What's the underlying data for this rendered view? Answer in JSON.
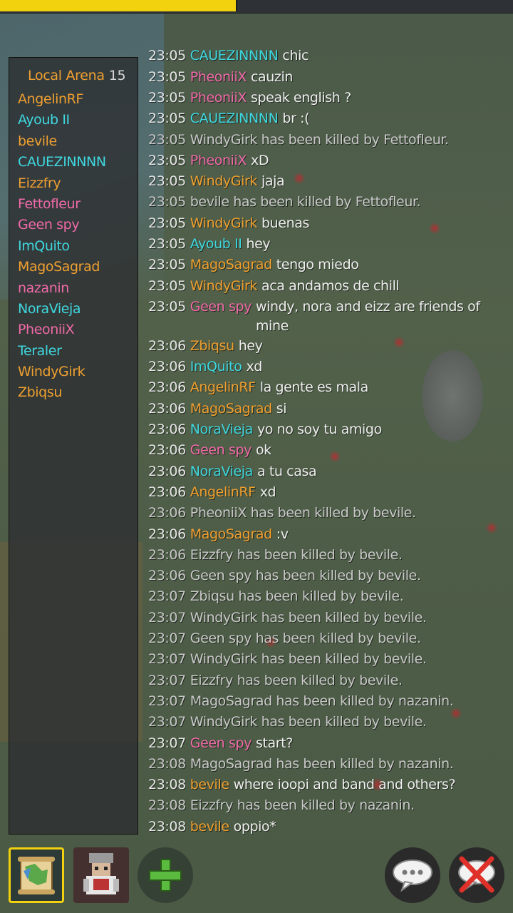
{
  "top_bar": {
    "progress": 0.46
  },
  "sidebar": {
    "title": "Local Arena",
    "count": "15",
    "players": [
      {
        "name": "AngelinRF",
        "color": "#f0a030"
      },
      {
        "name": "Ayoub II",
        "color": "#3fd8e0"
      },
      {
        "name": "bevile",
        "color": "#f0a030"
      },
      {
        "name": "CAUEZINNNN",
        "color": "#3fd8e0"
      },
      {
        "name": "Eizzfry",
        "color": "#f0a030"
      },
      {
        "name": "Fettofleur",
        "color": "#f06aa8"
      },
      {
        "name": "Geen spy",
        "color": "#f06aa8"
      },
      {
        "name": "ImQuito",
        "color": "#3fd8e0"
      },
      {
        "name": "MagoSagrad",
        "color": "#f0a030"
      },
      {
        "name": "nazanin",
        "color": "#f06aa8"
      },
      {
        "name": "NoraVieja",
        "color": "#3fd8e0"
      },
      {
        "name": "PheoniiX",
        "color": "#f06aa8"
      },
      {
        "name": "Teraler",
        "color": "#3fd8e0"
      },
      {
        "name": "WindyGirk",
        "color": "#f0a030"
      },
      {
        "name": "Zbiqsu",
        "color": "#f0a030"
      }
    ]
  },
  "chat": {
    "messages": [
      {
        "time": "23:05",
        "name": "CAUEZINNNN",
        "color": "#3fd8e0",
        "text": "chic"
      },
      {
        "time": "23:05",
        "name": "PheoniiX",
        "color": "#f06aa8",
        "text": "cauzin"
      },
      {
        "time": "23:05",
        "name": "PheoniiX",
        "color": "#f06aa8",
        "text": "speak english ?"
      },
      {
        "time": "23:05",
        "name": "CAUEZINNNN",
        "color": "#3fd8e0",
        "text": "br :("
      },
      {
        "time": "23:05",
        "name": "",
        "color": "",
        "text": "WindyGirk has been killed by Fettofleur."
      },
      {
        "time": "23:05",
        "name": "PheoniiX",
        "color": "#f06aa8",
        "text": "xD"
      },
      {
        "time": "23:05",
        "name": "WindyGirk",
        "color": "#f0a030",
        "text": "jaja"
      },
      {
        "time": "23:05",
        "name": "",
        "color": "",
        "text": "bevile has been killed by Fettofleur."
      },
      {
        "time": "23:05",
        "name": "WindyGirk",
        "color": "#f0a030",
        "text": "buenas"
      },
      {
        "time": "23:05",
        "name": "Ayoub II",
        "color": "#3fd8e0",
        "text": "hey"
      },
      {
        "time": "23:05",
        "name": "MagoSagrad",
        "color": "#f0a030",
        "text": "tengo miedo"
      },
      {
        "time": "23:05",
        "name": "WindyGirk",
        "color": "#f0a030",
        "text": "aca andamos de chill"
      },
      {
        "time": "23:05",
        "name": "Geen spy",
        "color": "#f06aa8",
        "text": "windy, nora and eizz are friends of mine"
      },
      {
        "time": "23:06",
        "name": "Zbiqsu",
        "color": "#f0a030",
        "text": "hey"
      },
      {
        "time": "23:06",
        "name": "ImQuito",
        "color": "#3fd8e0",
        "text": "xd"
      },
      {
        "time": "23:06",
        "name": "AngelinRF",
        "color": "#f0a030",
        "text": "la gente es mala"
      },
      {
        "time": "23:06",
        "name": "MagoSagrad",
        "color": "#f0a030",
        "text": "si"
      },
      {
        "time": "23:06",
        "name": "NoraVieja",
        "color": "#3fd8e0",
        "text": "yo no soy tu amigo"
      },
      {
        "time": "23:06",
        "name": "Geen spy",
        "color": "#f06aa8",
        "text": "ok"
      },
      {
        "time": "23:06",
        "name": "NoraVieja",
        "color": "#3fd8e0",
        "text": "a tu casa"
      },
      {
        "time": "23:06",
        "name": "AngelinRF",
        "color": "#f0a030",
        "text": "xd"
      },
      {
        "time": "23:06",
        "name": "",
        "color": "",
        "text": "PheoniiX has been killed by bevile."
      },
      {
        "time": "23:06",
        "name": "MagoSagrad",
        "color": "#f0a030",
        "text": ":v"
      },
      {
        "time": "23:06",
        "name": "",
        "color": "",
        "text": "Eizzfry has been killed by bevile."
      },
      {
        "time": "23:06",
        "name": "",
        "color": "",
        "text": "Geen spy has been killed by bevile."
      },
      {
        "time": "23:07",
        "name": "",
        "color": "",
        "text": "Zbiqsu has been killed by bevile."
      },
      {
        "time": "23:07",
        "name": "",
        "color": "",
        "text": "WindyGirk has been killed by bevile."
      },
      {
        "time": "23:07",
        "name": "",
        "color": "",
        "text": "Geen spy has been killed by bevile."
      },
      {
        "time": "23:07",
        "name": "",
        "color": "",
        "text": "WindyGirk has been killed by bevile."
      },
      {
        "time": "23:07",
        "name": "",
        "color": "",
        "text": "Eizzfry has been killed by bevile."
      },
      {
        "time": "23:07",
        "name": "",
        "color": "",
        "text": "MagoSagrad has been killed by nazanin."
      },
      {
        "time": "23:07",
        "name": "",
        "color": "",
        "text": "WindyGirk has been killed by bevile."
      },
      {
        "time": "23:07",
        "name": "Geen spy",
        "color": "#f06aa8",
        "text": "start?"
      },
      {
        "time": "23:08",
        "name": "",
        "color": "",
        "text": "MagoSagrad has been killed by nazanin."
      },
      {
        "time": "23:08",
        "name": "bevile",
        "color": "#f0a030",
        "text": "where ioopi and band and others?"
      },
      {
        "time": "23:08",
        "name": "",
        "color": "",
        "text": "Eizzfry has been killed by nazanin."
      },
      {
        "time": "23:08",
        "name": "bevile",
        "color": "#f0a030",
        "text": "oppio*"
      }
    ]
  },
  "toolbar": {
    "map_icon": "map-scroll-icon",
    "character_icon": "character-portrait-icon",
    "add_icon": "plus-icon",
    "chat_icon": "speech-bubble-icon",
    "mute_icon": "muted-chat-icon"
  },
  "colors": {
    "accent_yellow": "#f2d20e",
    "team_orange": "#f0a030",
    "team_cyan": "#3fd8e0",
    "team_pink": "#f06aa8",
    "system_text": "#c9c9c9"
  }
}
